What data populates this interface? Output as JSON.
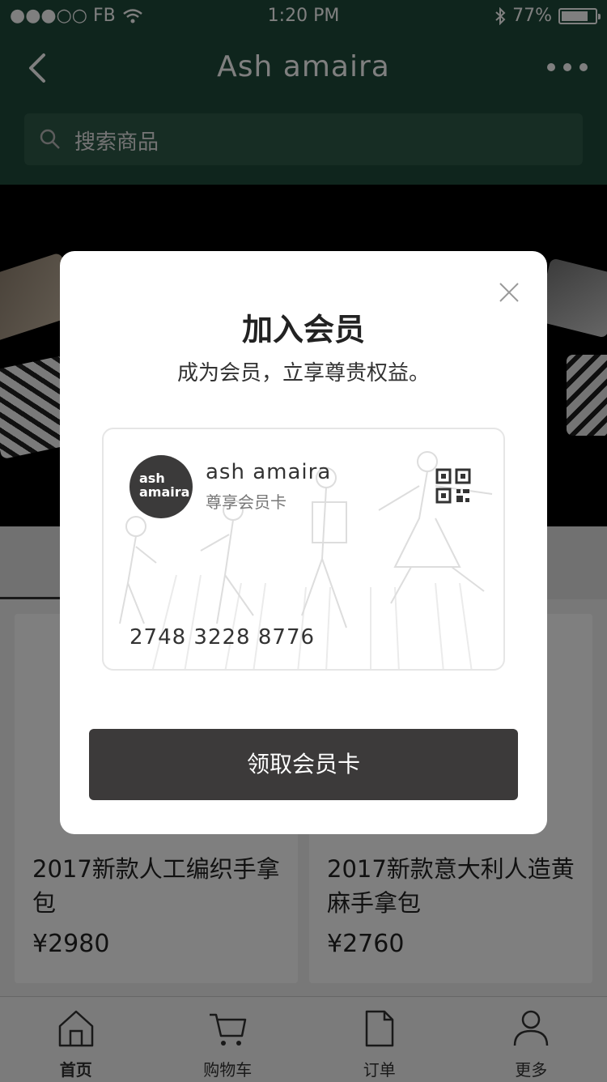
{
  "status_bar": {
    "carrier": "●●●○○ FB",
    "time": "1:20 PM",
    "battery_text": "77%",
    "battery_level": 0.77
  },
  "header": {
    "title": "Ash amaira"
  },
  "search": {
    "placeholder": "搜索商品"
  },
  "products": [
    {
      "name": "2017新款人工编织手拿包",
      "price": "¥2980"
    },
    {
      "name": "2017新款意大利人造黄麻手拿包",
      "price": "¥2760"
    }
  ],
  "tabbar": {
    "items": [
      {
        "label": "首页",
        "icon": "home-icon",
        "active": true
      },
      {
        "label": "购物车",
        "icon": "cart-icon",
        "active": false
      },
      {
        "label": "订单",
        "icon": "document-icon",
        "active": false
      },
      {
        "label": "更多",
        "icon": "user-icon",
        "active": false
      }
    ]
  },
  "modal": {
    "title": "加入会员",
    "subtitle": "成为会员，立享尊贵权益。",
    "card": {
      "logo_line1": "ash",
      "logo_line2": "amaira",
      "brand": "ash amaira",
      "type": "尊享会员卡",
      "number": "2748 3228 8776"
    },
    "button_label": "领取会员卡"
  }
}
